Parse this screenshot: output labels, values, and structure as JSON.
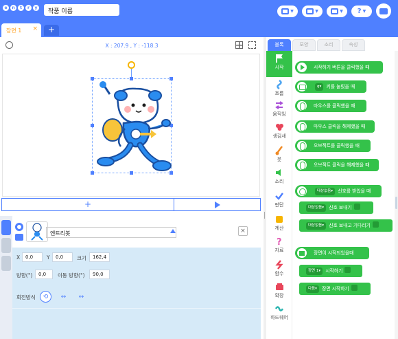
{
  "app": {
    "logo_letters": [
      "e",
      "n",
      "t",
      "r",
      "y"
    ],
    "project_name": "작품 이름"
  },
  "scene_tab": {
    "label": "장면 1",
    "close": "×"
  },
  "add_scene": "+",
  "stage": {
    "coords": "X : 207.9 , Y : -118.3",
    "add": "+"
  },
  "object": {
    "name": "엔트리봇",
    "delete": "×",
    "x_label": "X",
    "x_value": "0,0",
    "y_label": "Y",
    "y_value": "0,0",
    "size_label": "크기",
    "size_value": "162,4",
    "direction_label": "방향(°)",
    "direction_value": "0,0",
    "move_direction_label": "이동 방향(°)",
    "move_direction_value": "90,0",
    "rotation_label": "회전방식"
  },
  "tabs": [
    "블록",
    "모양",
    "소리",
    "속성"
  ],
  "categories": [
    "시작",
    "흐름",
    "움직임",
    "생김새",
    "붓",
    "소리",
    "판단",
    "계산",
    "자료",
    "함수",
    "확장",
    "하드웨어"
  ],
  "blocks": {
    "start_click": "시작하기 버튼을 클릭했을 때",
    "key_key": "q",
    "key_text": "키를 눌렀을 때",
    "mouse_click": "마우스를 클릭했을 때",
    "mouse_release": "마우스 클릭을 해제했을 때",
    "obj_click": "오브젝트를 클릭했을 때",
    "obj_release": "오브젝트 클릭을 해제했을 때",
    "signal_target": "대상없음",
    "signal_received": "신호를 받았을 때",
    "signal_send": "신호 보내기",
    "signal_send_wait": "신호 보내고 기다리기",
    "scene_start": "장면이 시작되었을때",
    "scene_name": "장면 1",
    "scene_go": "시작하기",
    "next_scene": "다음",
    "next_scene_text": "장면 시작하기"
  },
  "colors": {
    "brand": "#4f80ff",
    "start_block": "#34c24a",
    "scene_tab": "#ff9f1c",
    "selection_handle": "#4f80ff",
    "rotation_handle": "#f7b500"
  }
}
